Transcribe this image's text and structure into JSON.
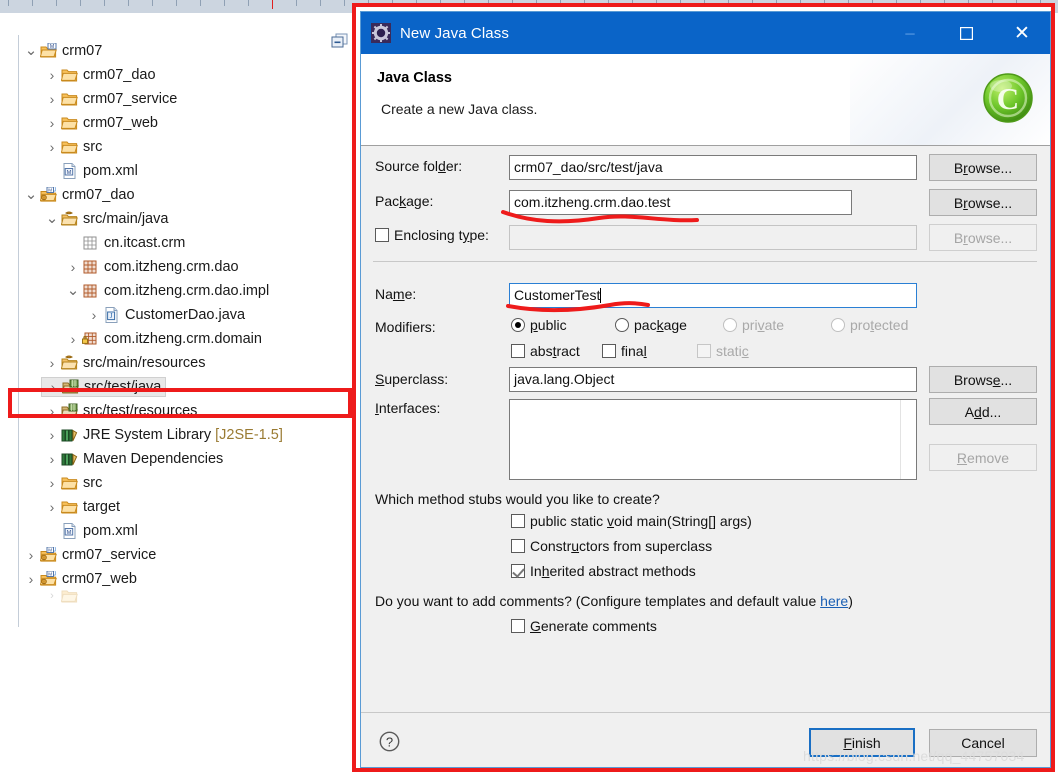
{
  "ruler": {
    "tick_count": 44,
    "red_tick_index": 11
  },
  "explorer": {
    "collapse_all_icon": "collapse-all-icon",
    "tree": [
      {
        "indent": 0,
        "arrow": "v",
        "icon": "maven-project-folder",
        "label": "crm07",
        "selected": false
      },
      {
        "indent": 1,
        "arrow": ">",
        "icon": "folder",
        "label": "crm07_dao",
        "selected": false
      },
      {
        "indent": 1,
        "arrow": ">",
        "icon": "folder",
        "label": "crm07_service",
        "selected": false
      },
      {
        "indent": 1,
        "arrow": ">",
        "icon": "folder",
        "label": "crm07_web",
        "selected": false
      },
      {
        "indent": 1,
        "arrow": ">",
        "icon": "folder",
        "label": "src",
        "selected": false
      },
      {
        "indent": 1,
        "arrow": "none",
        "icon": "maven-pom-file",
        "label": "pom.xml",
        "selected": false
      },
      {
        "indent": 0,
        "arrow": "v",
        "icon": "maven-java-project",
        "label": "crm07_dao",
        "selected": false
      },
      {
        "indent": 1,
        "arrow": "v",
        "icon": "source-folder",
        "label": "src/main/java",
        "selected": false
      },
      {
        "indent": 2,
        "arrow": "none",
        "icon": "package-empty",
        "label": "cn.itcast.crm",
        "selected": false
      },
      {
        "indent": 2,
        "arrow": ">",
        "icon": "package",
        "label": "com.itzheng.crm.dao",
        "selected": false
      },
      {
        "indent": 2,
        "arrow": "v",
        "icon": "package",
        "label": "com.itzheng.crm.dao.impl",
        "selected": false
      },
      {
        "indent": 3,
        "arrow": ">",
        "icon": "java-file",
        "label": "CustomerDao.java",
        "selected": false
      },
      {
        "indent": 2,
        "arrow": ">",
        "icon": "package-locked",
        "label": "com.itzheng.crm.domain",
        "selected": false
      },
      {
        "indent": 1,
        "arrow": ">",
        "icon": "source-folder",
        "label": "src/main/resources",
        "selected": false
      },
      {
        "indent": 1,
        "arrow": ">",
        "icon": "test-source-folder",
        "label": "src/test/java",
        "selected": true
      },
      {
        "indent": 1,
        "arrow": ">",
        "icon": "test-source-folder",
        "label": "src/test/resources",
        "selected": false
      },
      {
        "indent": 1,
        "arrow": ">",
        "icon": "library",
        "label": "JRE System Library",
        "suffix": " [J2SE-1.5]",
        "selected": false
      },
      {
        "indent": 1,
        "arrow": ">",
        "icon": "library",
        "label": "Maven Dependencies",
        "selected": false
      },
      {
        "indent": 1,
        "arrow": ">",
        "icon": "folder",
        "label": "src",
        "selected": false
      },
      {
        "indent": 1,
        "arrow": ">",
        "icon": "folder",
        "label": "target",
        "selected": false
      },
      {
        "indent": 1,
        "arrow": "none",
        "icon": "maven-pom-file",
        "label": "pom.xml",
        "selected": false
      },
      {
        "indent": 0,
        "arrow": ">",
        "icon": "maven-java-project",
        "label": "crm07_service",
        "selected": false
      },
      {
        "indent": 0,
        "arrow": ">",
        "icon": "maven-java-project",
        "label": "crm07_web",
        "selected": false
      }
    ]
  },
  "dialog": {
    "title": "New Java Class",
    "app_icon": "java-class-wizard-icon",
    "window_buttons": {
      "minimize": "─",
      "maximize": "☐",
      "close": "✕"
    },
    "header": {
      "title": "Java Class",
      "subtitle": "Create a new Java class.",
      "logo": "green-c-badge-icon"
    },
    "fields": {
      "source_folder": {
        "label_pre": "Source fol",
        "label_mnemonic": "d",
        "label_post": "er:",
        "value": "crm07_dao/src/test/java",
        "button": {
          "pre": "B",
          "mnemonic": "r",
          "post": "owse...",
          "enabled": true
        }
      },
      "package": {
        "label_pre": "Pac",
        "label_mnemonic": "k",
        "label_post": "age:",
        "value": "com.itzheng.crm.dao.test",
        "button": {
          "pre": "B",
          "mnemonic": "r",
          "post": "owse...",
          "enabled": true
        }
      },
      "enclosing_type": {
        "label_pre": "Enclosing t",
        "label_mnemonic": "y",
        "label_post": "pe:",
        "checked": false,
        "value": "",
        "button": {
          "pre": "B",
          "mnemonic": "r",
          "post": "owse...",
          "enabled": false
        }
      },
      "name": {
        "label_pre": "Na",
        "label_mnemonic": "m",
        "label_post": "e:",
        "value": "CustomerTest",
        "focused": true
      },
      "modifiers": {
        "label": "Modifiers:",
        "radios": [
          {
            "pre": "",
            "mnemonic": "p",
            "post": "ublic",
            "label": "public",
            "checked": true,
            "enabled": true
          },
          {
            "pre": "pac",
            "mnemonic": "k",
            "post": "age",
            "label": "package",
            "checked": false,
            "enabled": true
          },
          {
            "pre": "pri",
            "mnemonic": "v",
            "post": "ate",
            "label": "private",
            "checked": false,
            "enabled": false
          },
          {
            "pre": "pro",
            "mnemonic": "t",
            "post": "ected",
            "label": "protected",
            "checked": false,
            "enabled": false
          }
        ],
        "checkboxes": [
          {
            "pre": "abs",
            "mnemonic": "t",
            "post": "ract",
            "label": "abstract",
            "checked": false,
            "enabled": true
          },
          {
            "pre": "fina",
            "mnemonic": "l",
            "post": "",
            "label": "final",
            "checked": false,
            "enabled": true
          },
          {
            "pre": "stati",
            "mnemonic": "c",
            "post": "",
            "label": "static",
            "checked": false,
            "enabled": false
          }
        ]
      },
      "superclass": {
        "label_pre": "",
        "label_mnemonic": "S",
        "label_post": "uperclass:",
        "value": "java.lang.Object",
        "button": {
          "pre": "Brows",
          "mnemonic": "e",
          "post": "...",
          "enabled": true
        }
      },
      "interfaces": {
        "label_pre": "",
        "label_mnemonic": "I",
        "label_post": "nterfaces:",
        "items": [],
        "add_button": {
          "pre": "A",
          "mnemonic": "d",
          "post": "d...",
          "enabled": true
        },
        "remove_button": {
          "pre": "",
          "mnemonic": "R",
          "post": "emove",
          "enabled": false
        }
      }
    },
    "stubs": {
      "question": "Which method stubs would you like to create?",
      "options": [
        {
          "pre": "public static ",
          "mnemonic": "v",
          "post": "oid main(String[] args)",
          "label": "public static void main(String[] args)",
          "checked": false
        },
        {
          "pre": "Constr",
          "mnemonic": "u",
          "post": "ctors from superclass",
          "label": "Constructors from superclass",
          "checked": false
        },
        {
          "pre": "In",
          "mnemonic": "h",
          "post": "erited abstract methods",
          "label": "Inherited abstract methods",
          "checked": true
        }
      ]
    },
    "comments": {
      "question_pre": "Do you want to add comments? (Configure templates and default value ",
      "link": "here",
      "question_post": ")",
      "checkbox": {
        "pre": "",
        "mnemonic": "G",
        "post": "enerate comments",
        "label": "Generate comments",
        "checked": false
      }
    },
    "footer": {
      "help_icon": "help-question-icon",
      "finish": {
        "pre": "",
        "mnemonic": "F",
        "post": "inish",
        "label": "Finish",
        "default": true
      },
      "cancel": {
        "pre": "Cancel",
        "mnemonic": "",
        "post": "",
        "label": "Cancel",
        "default": false
      }
    }
  },
  "annotations": {
    "watermark": "https://blog.csdn.net/qq_44757034",
    "red_color": "#ee1b1b"
  }
}
